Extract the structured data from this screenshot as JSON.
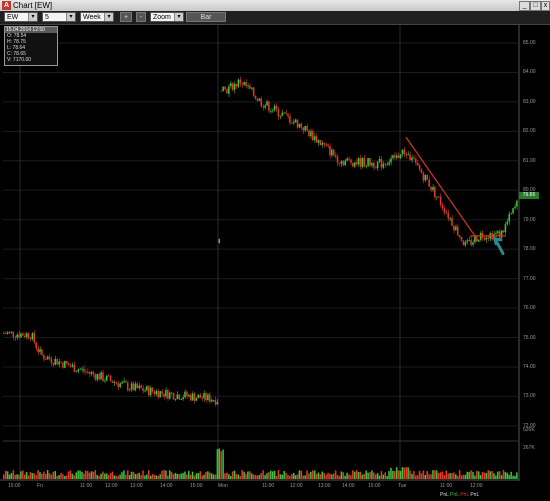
{
  "window": {
    "title": "Chart [EW]",
    "app_icon": "A"
  },
  "toolbar": {
    "symbol": "EW",
    "interval": "5 minutes",
    "range": "Week",
    "plus": "+",
    "minus": "-",
    "zoom": "Zoom",
    "bar": "Bar"
  },
  "infobox": {
    "header": "15.04.2014 12:50",
    "open": "O: 78.54",
    "high": "H: 78.75",
    "low": "L: 78.64",
    "close": "C: 78.65",
    "volume": "V: 7170.00"
  },
  "colors": {
    "up": "#3cc43c",
    "down": "#e23a2a",
    "trend": "#cc3322",
    "arrow": "#2a8a8a",
    "grid": "#1c1c1c"
  },
  "yaxis": [
    "85.00",
    "84.00",
    "83.00",
    "82.00",
    "81.00",
    "80.00",
    "79.00",
    "78.00",
    "77.00",
    "76.00",
    "75.00",
    "74.00",
    "73.00",
    "72.00"
  ],
  "vol_axis": [
    "535K",
    "267K"
  ],
  "xaxis": [
    "15:00",
    "Fri",
    "11:00",
    "12:00",
    "13:00",
    "14:00",
    "15:00",
    "Mon",
    "11:00",
    "12:00",
    "13:00",
    "14:00",
    "15:00",
    "Tue",
    "11:00",
    "12:00"
  ],
  "last_price": "79.65",
  "status": [
    "PnL",
    "PnL",
    "PnL",
    "PnL"
  ]
}
